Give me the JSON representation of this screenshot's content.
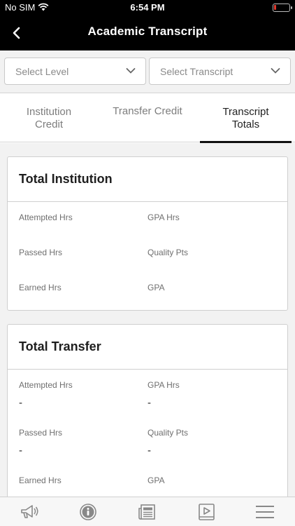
{
  "status_bar": {
    "carrier": "No SIM",
    "time": "6:54 PM",
    "battery_color": "#e0382c"
  },
  "header": {
    "title": "Academic Transcript",
    "back_icon": "chevron-left-icon"
  },
  "filters": {
    "level": {
      "label": "Select Level"
    },
    "transcript": {
      "label": "Select Transcript"
    }
  },
  "tabs": [
    {
      "line1": "Institution",
      "line2": "Credit",
      "active": false
    },
    {
      "line1": "Transfer Credit",
      "line2": "",
      "active": false
    },
    {
      "line1": "Transcript",
      "line2": "Totals",
      "active": true
    }
  ],
  "cards": {
    "institution": {
      "title": "Total Institution",
      "fields": {
        "attempted_hrs": {
          "label": "Attempted Hrs",
          "value": ""
        },
        "gpa_hrs": {
          "label": "GPA Hrs",
          "value": ""
        },
        "passed_hrs": {
          "label": "Passed Hrs",
          "value": ""
        },
        "quality_pts": {
          "label": "Quality Pts",
          "value": ""
        },
        "earned_hrs": {
          "label": "Earned Hrs",
          "value": ""
        },
        "gpa": {
          "label": "GPA",
          "value": ""
        }
      }
    },
    "transfer": {
      "title": "Total Transfer",
      "fields": {
        "attempted_hrs": {
          "label": "Attempted Hrs",
          "value": "-"
        },
        "gpa_hrs": {
          "label": "GPA Hrs",
          "value": "-"
        },
        "passed_hrs": {
          "label": "Passed Hrs",
          "value": "-"
        },
        "quality_pts": {
          "label": "Quality Pts",
          "value": "-"
        },
        "earned_hrs": {
          "label": "Earned Hrs",
          "value": ""
        },
        "gpa": {
          "label": "GPA",
          "value": ""
        }
      }
    }
  },
  "tab_bar": {
    "icons": [
      "megaphone-icon",
      "info-icon",
      "news-icon",
      "video-icon",
      "menu-icon"
    ]
  }
}
